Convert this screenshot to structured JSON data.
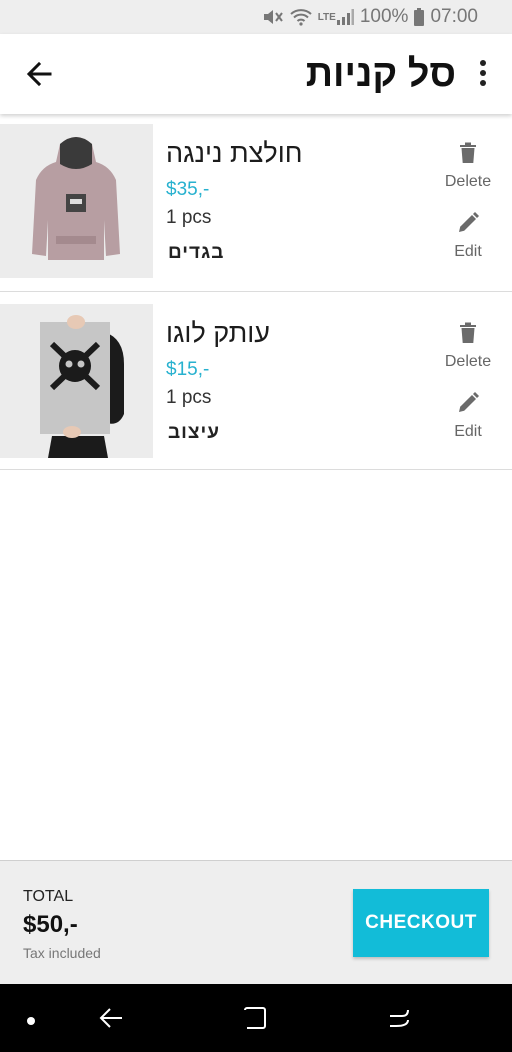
{
  "status_bar": {
    "battery": "100%",
    "time": "07:00",
    "network": "LTE"
  },
  "app_bar": {
    "title": "סל קניות"
  },
  "cart": {
    "items": [
      {
        "name": "חולצת נינגה",
        "price": "$35,-",
        "qty": "1 pcs",
        "category": "בגדים",
        "delete_label": "Delete",
        "edit_label": "Edit"
      },
      {
        "name": "עותק לוגו",
        "price": "$15,-",
        "qty": "1 pcs",
        "category": "עיצוב",
        "delete_label": "Delete",
        "edit_label": "Edit"
      }
    ]
  },
  "footer": {
    "total_label": "TOTAL",
    "total_value": "$50,-",
    "tax_label": "Tax included",
    "checkout_label": "CHECKOUT"
  },
  "colors": {
    "accent": "#12bcd8",
    "price": "#27b1cf"
  }
}
